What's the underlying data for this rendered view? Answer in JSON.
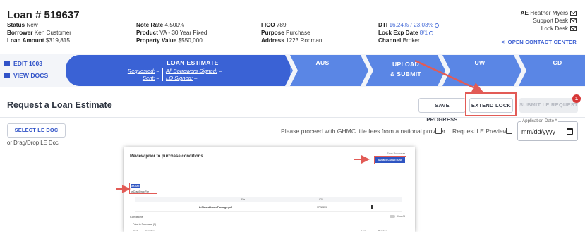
{
  "loan": {
    "title": "Loan # 519637",
    "status_label": "Status",
    "status": "New",
    "borrower_label": "Borrower",
    "borrower": "Ken Customer",
    "amount_label": "Loan Amount",
    "amount": "$319,815",
    "note_rate_label": "Note Rate",
    "note_rate": "4.500%",
    "product_label": "Product",
    "product": "VA - 30 Year Fixed",
    "property_value_label": "Property Value",
    "property_value": "$550,000",
    "fico_label": "FICO",
    "fico": "789",
    "purpose_label": "Purpose",
    "purpose": "Purchase",
    "address_label": "Address",
    "address": "1223 Rodman",
    "dti_label": "DTI",
    "dti": "16.24% / 23.03%",
    "lock_exp_label": "Lock Exp Date",
    "lock_exp": "8/1",
    "channel_label": "Channel",
    "channel": "Broker"
  },
  "contacts": {
    "ae_label": "AE",
    "ae_name": "Heather Myers",
    "support_desk": "Support Desk",
    "lock_desk": "Lock Desk",
    "open_contact_center": "OPEN CONTACT CENTER",
    "chevron": "<"
  },
  "left_links": {
    "edit_1003": "EDIT 1003",
    "view_docs": "VIEW DOCS"
  },
  "stages": {
    "loan_estimate": "LOAN ESTIMATE",
    "requested_label": "Requested:",
    "requested_value": "–",
    "sent_label": "Sent:",
    "sent_value": "–",
    "all_borrowers_signed_label": "All Borrowers Signed:",
    "all_borrowers_signed_value": "–",
    "lo_signed_label": "LO Signed:",
    "lo_signed_value": "–",
    "aus": "AUS",
    "upload_line1": "UPLOAD",
    "upload_line2": "& SUBMIT",
    "uw": "UW",
    "cd": "CD"
  },
  "request": {
    "title": "Request a Loan Estimate",
    "save_progress": "SAVE PROGRESS",
    "extend_lock": "EXTEND LOCK",
    "submit_le_request": "SUBMIT LE REQUEST",
    "badge_count": "1",
    "select_le_doc": "SELECT LE DOC",
    "drag_drop": "or Drag/Drop LE Doc",
    "ghmc_text": "Please proceed with GHMC title fees from a national provider",
    "le_preview": "Request LE Preview",
    "app_date_label": "Application Date *",
    "app_date_placeholder": "mm/dd/yyyy"
  },
  "embedded": {
    "title": "Review prior to purchase conditions",
    "save_purchaser": "Save Purchaser",
    "submit_conditions": "SUBMIT CONDITIONS",
    "upload": "UPLOAD",
    "drag_drop": "or Drag/Drop File",
    "col_file": "File",
    "col_icon": "ICN",
    "file_name": "2-Closed Loan Package.pdf",
    "file_icn": "1728379",
    "conditions": "Conditions",
    "show_all": "Show All",
    "prior_to_purchase": "Prior to Purchase (3)",
    "foot_code": "Code",
    "foot_condition": "Condition",
    "foot_last": "Last",
    "foot_received": "Received"
  },
  "colors": {
    "stage_active": "#3a62d5",
    "stage_inactive": "#5a86e5",
    "link_blue": "#3153c8",
    "annotation_red": "#e25b56",
    "badge_red": "#d73737"
  }
}
